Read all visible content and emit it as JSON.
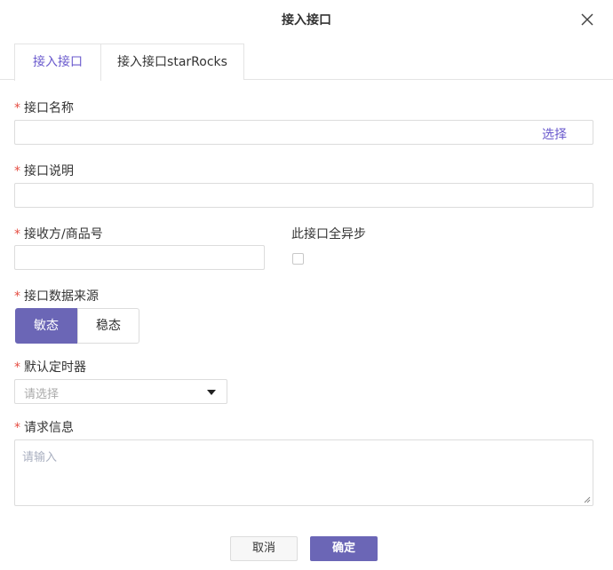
{
  "dialog": {
    "title": "接入接口"
  },
  "tabs": [
    {
      "label": "接入接口",
      "active": true
    },
    {
      "label": "接入接口starRocks",
      "active": false
    }
  ],
  "form": {
    "required_mark": "*",
    "interface_name": {
      "label": "接口名称",
      "value": "",
      "select_link": "选择"
    },
    "interface_desc": {
      "label": "接口说明",
      "value": ""
    },
    "receiver": {
      "label": "接收方/商品号",
      "value": ""
    },
    "async_all": {
      "label": "此接口全异步",
      "checked": false
    },
    "data_source": {
      "label": "接口数据来源",
      "options": [
        "敏态",
        "稳态"
      ],
      "selected": "敏态"
    },
    "timer": {
      "label": "默认定时器",
      "placeholder": "请选择"
    },
    "request_info": {
      "label": "请求信息",
      "placeholder": "请输入"
    }
  },
  "footer": {
    "cancel_label": "取消",
    "ok_label": "确定"
  },
  "colors": {
    "accent": "#6b66b6",
    "link": "#6a5acd",
    "required": "#e54d42"
  }
}
